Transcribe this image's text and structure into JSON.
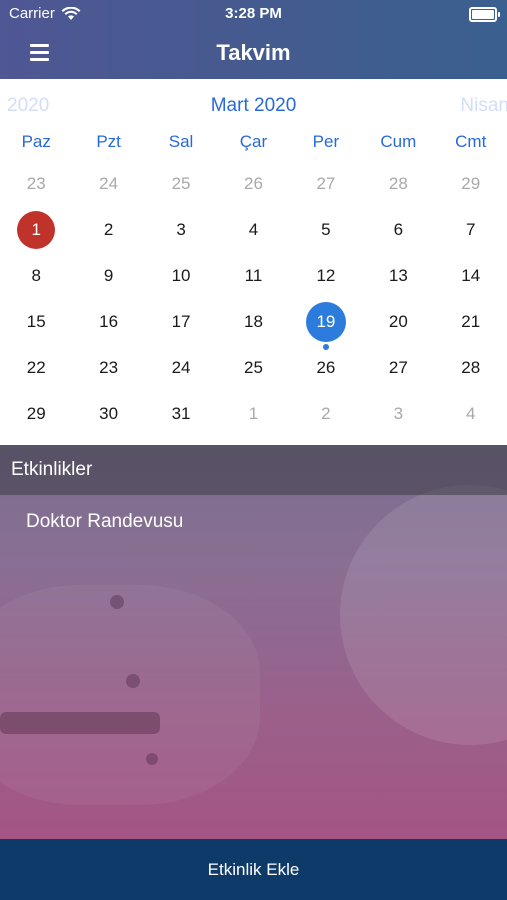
{
  "status_bar": {
    "carrier": "Carrier",
    "time": "3:28 PM"
  },
  "nav": {
    "title": "Takvim",
    "menu_icon": "hamburger-icon"
  },
  "calendar": {
    "prev_label": "2020",
    "current_label": "Mart 2020",
    "next_label": "Nisan",
    "weekdays": [
      "Paz",
      "Pzt",
      "Sal",
      "Çar",
      "Per",
      "Cum",
      "Cmt"
    ],
    "weeks": [
      [
        {
          "d": "23",
          "muted": true
        },
        {
          "d": "24",
          "muted": true
        },
        {
          "d": "25",
          "muted": true
        },
        {
          "d": "26",
          "muted": true
        },
        {
          "d": "27",
          "muted": true
        },
        {
          "d": "28",
          "muted": true
        },
        {
          "d": "29",
          "muted": true
        }
      ],
      [
        {
          "d": "1",
          "today": true
        },
        {
          "d": "2"
        },
        {
          "d": "3"
        },
        {
          "d": "4"
        },
        {
          "d": "5"
        },
        {
          "d": "6"
        },
        {
          "d": "7"
        }
      ],
      [
        {
          "d": "8"
        },
        {
          "d": "9"
        },
        {
          "d": "10"
        },
        {
          "d": "11"
        },
        {
          "d": "12"
        },
        {
          "d": "13"
        },
        {
          "d": "14"
        }
      ],
      [
        {
          "d": "15"
        },
        {
          "d": "16"
        },
        {
          "d": "17"
        },
        {
          "d": "18"
        },
        {
          "d": "19",
          "selected": true
        },
        {
          "d": "20"
        },
        {
          "d": "21"
        }
      ],
      [
        {
          "d": "22"
        },
        {
          "d": "23"
        },
        {
          "d": "24"
        },
        {
          "d": "25"
        },
        {
          "d": "26"
        },
        {
          "d": "27"
        },
        {
          "d": "28"
        }
      ],
      [
        {
          "d": "29"
        },
        {
          "d": "30"
        },
        {
          "d": "31"
        },
        {
          "d": "1",
          "muted": true
        },
        {
          "d": "2",
          "muted": true
        },
        {
          "d": "3",
          "muted": true
        },
        {
          "d": "4",
          "muted": true
        }
      ]
    ],
    "colors": {
      "accent": "#2869d8",
      "today": "#c0332b",
      "selected": "#2b7cdc"
    }
  },
  "events": {
    "header": "Etkinlikler",
    "items": [
      "Doktor Randevusu"
    ]
  },
  "footer": {
    "add_label": "Etkinlik Ekle",
    "color": "#0e3a69"
  }
}
